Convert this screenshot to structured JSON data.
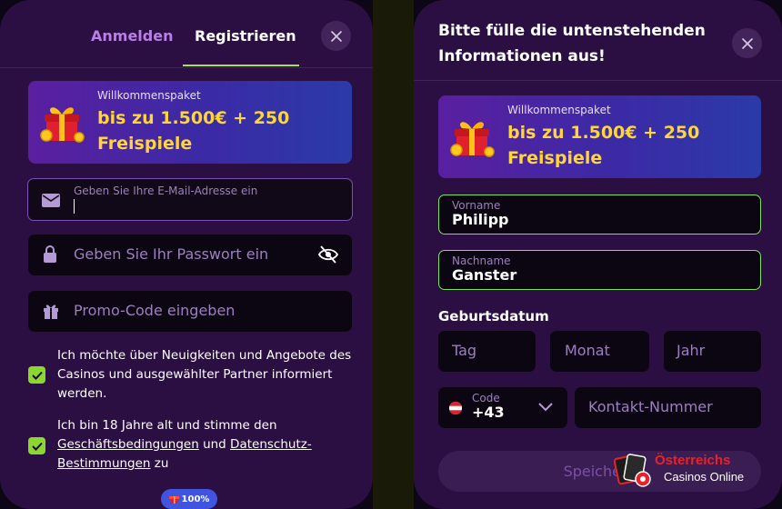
{
  "left_panel": {
    "tabs": [
      {
        "label": "Anmelden"
      },
      {
        "label": "Registrieren"
      }
    ],
    "promo": {
      "small": "Willkommenspaket",
      "line1": "bis zu 1.500€ + 250",
      "line2": "Freispiele"
    },
    "email": {
      "placeholder": "Geben Sie Ihre E-Mail-Adresse ein"
    },
    "password": {
      "placeholder": "Geben Sie Ihr Passwort ein"
    },
    "promo_code": {
      "placeholder": "Promo-Code eingeben"
    },
    "consents": [
      {
        "text": "Ich möchte über Neuigkeiten und Angebote des Casinos und ausgewählter Partner informiert werden.",
        "checked": true
      },
      {
        "prefix": "Ich bin 18 Jahre alt und stimme den",
        "link1": "Geschäftsbedingungen",
        "middle": "und",
        "link2": "Datenschutz-Bestimmungen",
        "suffix": "zu",
        "checked": true
      }
    ],
    "progress_badge": "100%"
  },
  "right_panel": {
    "title_line1": "Bitte fülle die untenstehenden",
    "title_line2": "Informationen aus!",
    "promo": {
      "small": "Willkommenspaket",
      "line1": "bis zu 1.500€ + 250",
      "line2": "Freispiele"
    },
    "first_name": {
      "label": "Vorname",
      "value": "Philipp"
    },
    "last_name": {
      "label": "Nachname",
      "value": "Ganster"
    },
    "birthdate": {
      "label": "Geburtsdatum",
      "day": "Tag",
      "month": "Monat",
      "year": "Jahr"
    },
    "phone": {
      "code_label": "Code",
      "code_value": "+43",
      "number_placeholder": "Kontakt-Nummer"
    },
    "save_button": "Speichern"
  },
  "watermark": {
    "title": "Österreichs",
    "subtitle": "Casinos Online"
  },
  "colors": {
    "panel": "#2c0f42",
    "accent_green": "#8ad82f",
    "promo_yellow": "#ffd638",
    "muted_purple": "#9d7fc0"
  },
  "icons": [
    "close-icon",
    "gift-icon",
    "mail-icon",
    "lock-icon",
    "eye-off-icon",
    "present-icon",
    "check-icon",
    "chevron-down-icon",
    "austria-flag-icon"
  ]
}
